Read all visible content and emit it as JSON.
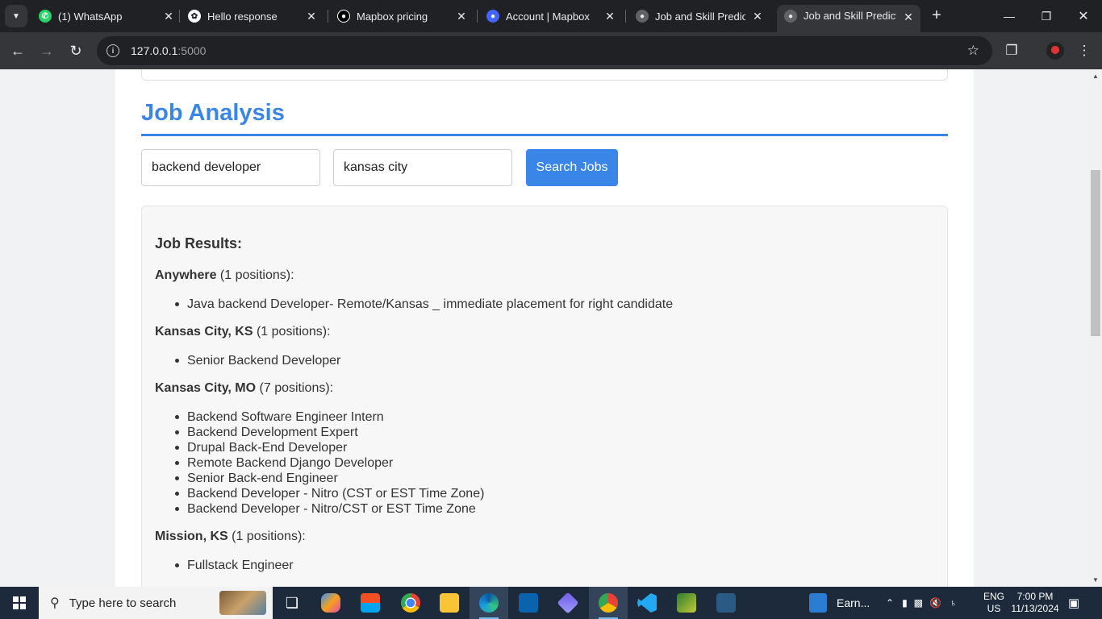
{
  "browser": {
    "tabs": [
      {
        "title": "(1) WhatsApp",
        "icon": "whatsapp-icon",
        "active": false
      },
      {
        "title": "Hello response",
        "icon": "openai-icon",
        "active": false
      },
      {
        "title": "Mapbox pricing",
        "icon": "mapbox-icon",
        "active": false
      },
      {
        "title": "Account | Mapbox",
        "icon": "mapbox-account-icon",
        "active": false
      },
      {
        "title": "Job and Skill Predictio",
        "icon": "globe-icon",
        "active": false
      },
      {
        "title": "Job and Skill Predictio",
        "icon": "globe-icon",
        "active": true
      }
    ],
    "url_host": "127.0.0.1",
    "url_port": ":5000"
  },
  "page": {
    "section_title": "Job Analysis",
    "job_title_input": "backend developer",
    "location_input": "kansas city",
    "search_button": "Search Jobs",
    "results_heading": "Job Results:",
    "groups": [
      {
        "location": "Anywhere",
        "count_text": " (1 positions):",
        "jobs": [
          "Java backend Developer- Remote/Kansas _ immediate placement for right candidate"
        ]
      },
      {
        "location": "Kansas City, KS",
        "count_text": " (1 positions):",
        "jobs": [
          "Senior Backend Developer"
        ]
      },
      {
        "location": "Kansas City, MO",
        "count_text": " (7 positions):",
        "jobs": [
          "Backend Software Engineer Intern",
          "Backend Development Expert",
          "Drupal Back-End Developer",
          "Remote Backend Django Developer",
          "Senior Back-end Engineer",
          "Backend Developer - Nitro (CST or EST Time Zone)",
          "Backend Developer - Nitro/CST or EST Time Zone"
        ]
      },
      {
        "location": "Mission, KS",
        "count_text": " (1 positions):",
        "jobs": [
          "Fullstack Engineer"
        ]
      }
    ]
  },
  "taskbar": {
    "search_placeholder": "Type here to search",
    "pinned_doc_label": "Earn...",
    "language": "ENG",
    "region": "US",
    "time": "7:00 PM",
    "date": "11/13/2024"
  },
  "colors": {
    "accent": "#3a86e8",
    "browser_dark": "#202124",
    "toolbar": "#35363a",
    "taskbar": "#1c2a3c"
  }
}
